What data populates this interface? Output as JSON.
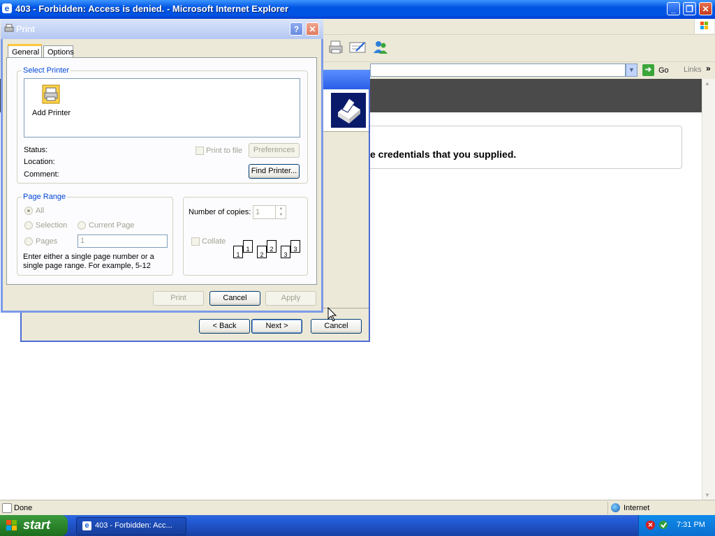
{
  "ie": {
    "title": "403 - Forbidden: Access is denied. - Microsoft Internet Explorer",
    "address": {
      "go_label": "Go",
      "links_label": "Links"
    },
    "content": {
      "error_text": "e credentials that you supplied."
    },
    "status": {
      "left": "Done",
      "zone": "Internet"
    }
  },
  "wizard": {
    "buttons": {
      "back": "< Back",
      "next": "Next >",
      "cancel": "Cancel"
    }
  },
  "print": {
    "title": "Print",
    "tabs": [
      "General",
      "Options"
    ],
    "select_printer": {
      "title": "Select Printer",
      "items": [
        {
          "label": "Add Printer"
        }
      ],
      "status_label": "Status:",
      "location_label": "Location:",
      "comment_label": "Comment:",
      "print_to_file": "Print to file",
      "preferences": "Preferences",
      "find_printer": "Find Printer..."
    },
    "page_range": {
      "title": "Page Range",
      "all": "All",
      "selection": "Selection",
      "current_page": "Current Page",
      "pages": "Pages",
      "pages_value": "1",
      "hint": "Enter either a single page number or a single page range.  For example, 5-12"
    },
    "copies": {
      "label": "Number of copies:",
      "value": "1",
      "collate": "Collate",
      "sheet_numbers": [
        "1",
        "1",
        "2",
        "2",
        "3",
        "3"
      ]
    },
    "buttons": {
      "print": "Print",
      "cancel": "Cancel",
      "apply": "Apply"
    }
  },
  "taskbar": {
    "start": "start",
    "task_item": "403 - Forbidden: Acc...",
    "clock": "7:31 PM"
  }
}
